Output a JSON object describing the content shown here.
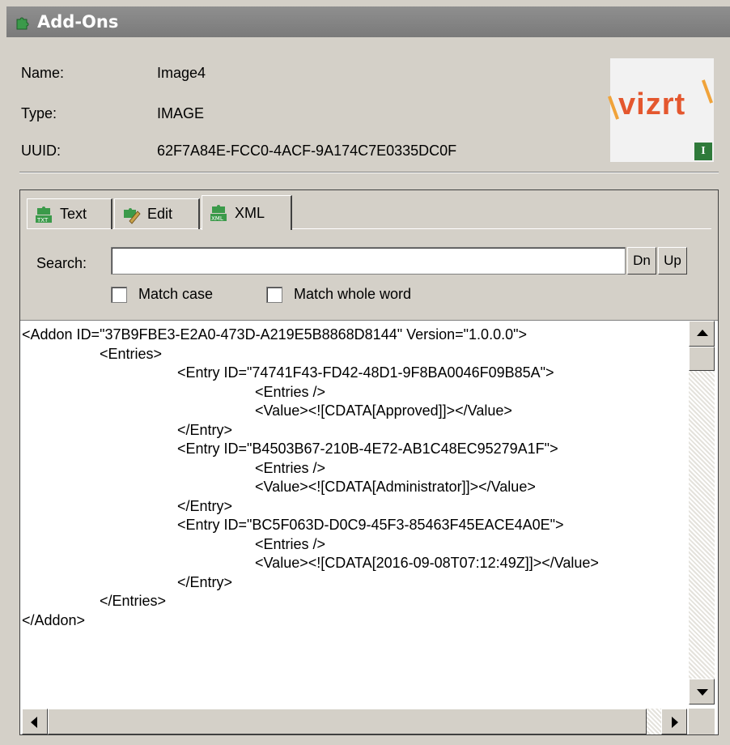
{
  "window": {
    "title": "Add-Ons"
  },
  "info": {
    "name_label": "Name:",
    "name_value": "Image4",
    "type_label": "Type:",
    "type_value": "IMAGE",
    "uuid_label": "UUID:",
    "uuid_value": "62F7A84E-FCC0-4ACF-9A174C7E0335DC0F"
  },
  "logo": {
    "text": "vizrt",
    "badge": "I"
  },
  "tabs": [
    {
      "label": "Text",
      "icon": "txt-icon",
      "active": false
    },
    {
      "label": "Edit",
      "icon": "edit-icon",
      "active": false
    },
    {
      "label": "XML",
      "icon": "xml-icon",
      "active": true
    }
  ],
  "search": {
    "label": "Search:",
    "value": "",
    "down_label": "Dn",
    "up_label": "Up",
    "match_case_label": "Match case",
    "match_case_checked": false,
    "match_whole_word_label": "Match whole word",
    "match_whole_word_checked": false
  },
  "xml_lines": [
    "<Addon ID=\"37B9FBE3-E2A0-473D-A219E5B8868D8144\" Version=\"1.0.0.0\">",
    "\t\t<Entries>",
    "\t\t\t\t<Entry ID=\"74741F43-FD42-48D1-9F8BA0046F09B85A\">",
    "\t\t\t\t\t\t<Entries />",
    "\t\t\t\t\t\t<Value><![CDATA[Approved]]></Value>",
    "\t\t\t\t</Entry>",
    "\t\t\t\t<Entry ID=\"B4503B67-210B-4E72-AB1C48EC95279A1F\">",
    "\t\t\t\t\t\t<Entries />",
    "\t\t\t\t\t\t<Value><![CDATA[Administrator]]></Value>",
    "\t\t\t\t</Entry>",
    "\t\t\t\t<Entry ID=\"BC5F063D-D0C9-45F3-85463F45EACE4A0E\">",
    "\t\t\t\t\t\t<Entries />",
    "\t\t\t\t\t\t<Value><![CDATA[2016-09-08T07:12:49Z]]></Value>",
    "\t\t\t\t</Entry>",
    "\t\t</Entries>",
    "</Addon>"
  ],
  "colors": {
    "titlebar": "#7f7f7f",
    "window_bg": "#d4d0c8",
    "logo_text": "#e4572e",
    "logo_accent": "#f0a33a",
    "badge": "#2f7a3a"
  }
}
